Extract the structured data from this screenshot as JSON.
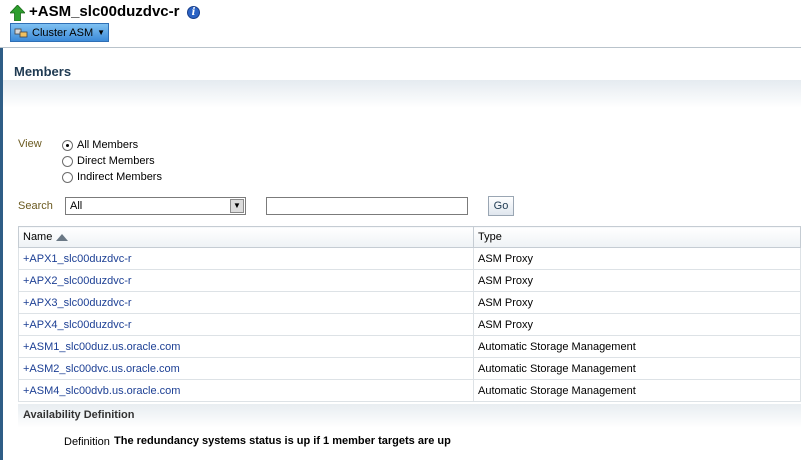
{
  "header": {
    "title": "+ASM_slc00duzdvc-r",
    "info_glyph": "i",
    "target_menu_label": "Cluster ASM",
    "icons": {
      "status": "up-arrow-icon",
      "info": "info-icon",
      "menu": "cluster-asm-icon"
    },
    "colors": {
      "status_up": "#2e9e2e",
      "menu_accent": "#3c8ad8"
    }
  },
  "members": {
    "section_title": "Members",
    "view": {
      "label": "View",
      "options": [
        {
          "label": "All Members",
          "checked": true
        },
        {
          "label": "Direct Members",
          "checked": false
        },
        {
          "label": "Indirect Members",
          "checked": false
        }
      ]
    },
    "search": {
      "label": "Search",
      "select_value": "All",
      "input_value": "",
      "go_label": "Go"
    },
    "table": {
      "columns": [
        "Name",
        "Type"
      ],
      "sort_column": "Name",
      "rows": [
        {
          "name": "+APX1_slc00duzdvc-r",
          "type": "ASM Proxy"
        },
        {
          "name": "+APX2_slc00duzdvc-r",
          "type": "ASM Proxy"
        },
        {
          "name": "+APX3_slc00duzdvc-r",
          "type": "ASM Proxy"
        },
        {
          "name": "+APX4_slc00duzdvc-r",
          "type": "ASM Proxy"
        },
        {
          "name": "+ASM1_slc00duz.us.oracle.com",
          "type": "Automatic Storage Management"
        },
        {
          "name": "+ASM2_slc00dvc.us.oracle.com",
          "type": "Automatic Storage Management"
        },
        {
          "name": "+ASM4_slc00dvb.us.oracle.com",
          "type": "Automatic Storage Management"
        }
      ]
    }
  },
  "availability": {
    "title": "Availability Definition",
    "definition_label": "Definition",
    "definition_value": "The redundancy systems status is up if 1 member targets are up"
  }
}
